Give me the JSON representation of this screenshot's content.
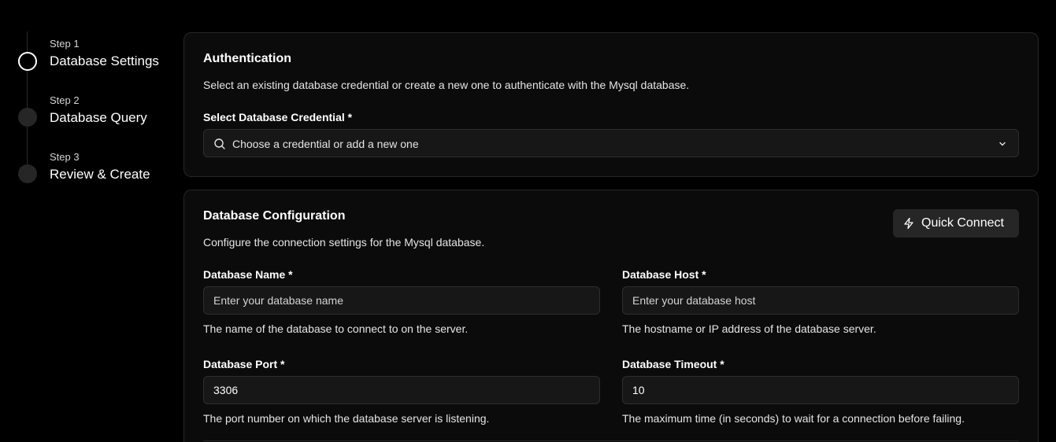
{
  "stepper": {
    "steps": [
      {
        "number": "Step 1",
        "title": "Database Settings",
        "state": "active"
      },
      {
        "number": "Step 2",
        "title": "Database Query",
        "state": "inactive"
      },
      {
        "number": "Step 3",
        "title": "Review & Create",
        "state": "inactive"
      }
    ]
  },
  "authentication": {
    "title": "Authentication",
    "description": "Select an existing database credential or create a new one to authenticate with the Mysql database.",
    "credential_label": "Select Database Credential *",
    "credential_placeholder": "Choose a credential or add a new one"
  },
  "configuration": {
    "title": "Database Configuration",
    "description": "Configure the connection settings for the Mysql database.",
    "quick_connect_label": "Quick Connect",
    "fields": {
      "name": {
        "label": "Database Name *",
        "value": "",
        "placeholder": "Enter your database name",
        "help": "The name of the database to connect to on the server."
      },
      "host": {
        "label": "Database Host *",
        "value": "",
        "placeholder": "Enter your database host",
        "help": "The hostname or IP address of the database server."
      },
      "port": {
        "label": "Database Port *",
        "value": "3306",
        "placeholder": "",
        "help": "The port number on which the database server is listening."
      },
      "timeout": {
        "label": "Database Timeout *",
        "value": "10",
        "placeholder": "",
        "help": "The maximum time (in seconds) to wait for a connection before failing."
      }
    }
  },
  "icons": {
    "search": "search-icon",
    "chevron": "chevron-down-icon",
    "lightning": "lightning-icon"
  },
  "colors": {
    "background": "#000000",
    "card_background": "#0b0b0b",
    "card_border": "#262626",
    "input_background": "#171717",
    "button_background": "#262626",
    "text": "#ffffff"
  }
}
